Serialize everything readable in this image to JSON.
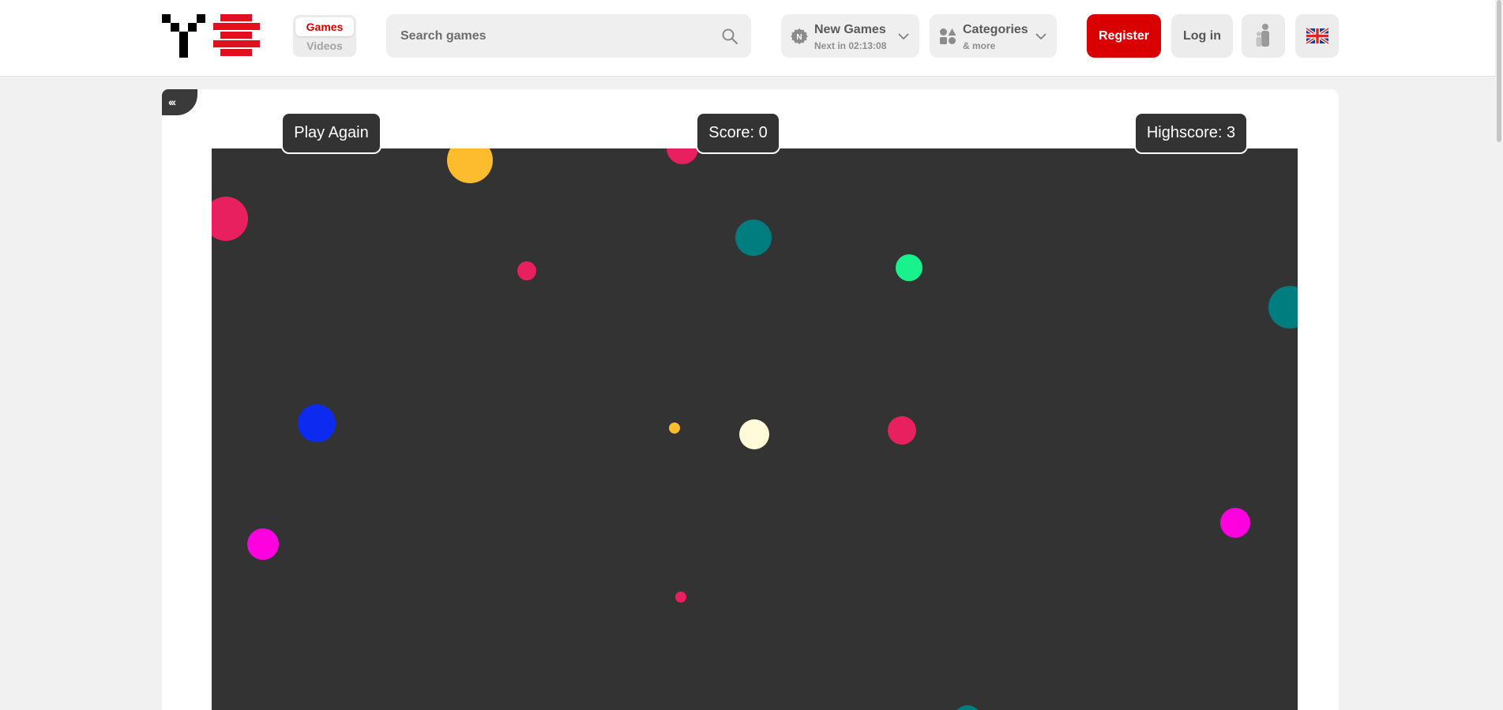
{
  "header": {
    "logo_alt": "Y8",
    "content_switch": {
      "active": "Games",
      "inactive": "Videos"
    },
    "search": {
      "placeholder": "Search games"
    },
    "new_games": {
      "title": "New Games",
      "subtitle": "Next in 02:13:08",
      "badge": "N"
    },
    "categories": {
      "title": "Categories",
      "subtitle": "& more"
    },
    "register_label": "Register",
    "login_label": "Log in",
    "icons": {
      "search": "search-icon",
      "new_games": "n-badge-icon",
      "categories": "shapes-icon",
      "parents": "family-icon",
      "language": "uk-flag-icon",
      "dropdown": "chevron-down-icon"
    }
  },
  "sidebar_toggle": {
    "label": "‹‹‹"
  },
  "game": {
    "play_again_label": "Play Again",
    "score_text": "Score: 0",
    "highscore_text": "Highscore: 3",
    "colors": {
      "background": "#333333",
      "yellow": "#fcbc2e",
      "pink": "#e8205f",
      "teal": "#007d7f",
      "green": "#19f28c",
      "blue": "#0d2bf0",
      "cream": "#fffbd8",
      "magenta": "#ff00de"
    }
  },
  "colors": {
    "brand_red": "#d80000",
    "page_bg": "#f1f1f1"
  }
}
